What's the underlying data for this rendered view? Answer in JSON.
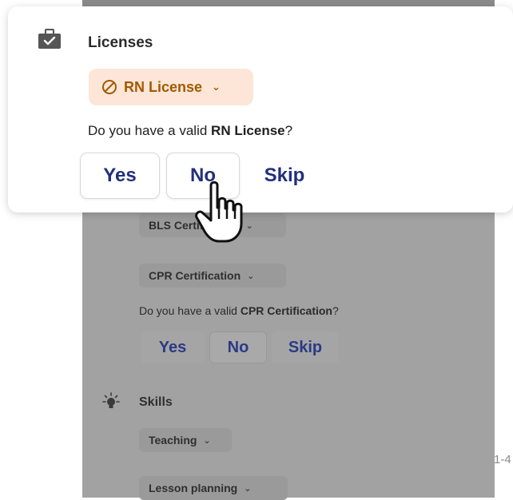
{
  "licenses_card": {
    "title": "Licenses",
    "license_pill": "RN License",
    "question_prefix": "Do you have a valid ",
    "question_bold": "RN License",
    "question_suffix": "?",
    "buttons": [
      "Yes",
      "No",
      "Skip"
    ]
  },
  "background": {
    "bls_pill": "BLS Certification",
    "cpr_pill": "CPR Certification",
    "cpr_question_prefix": "Do you have a valid ",
    "cpr_question_bold": "CPR Certification",
    "cpr_question_suffix": "?",
    "cpr_buttons": [
      "Yes",
      "No",
      "Skip"
    ],
    "skills_title": "Skills",
    "skills": [
      "Teaching",
      "Lesson planning"
    ],
    "page_marker": "1-4"
  },
  "colors": {
    "accent_text": "#22307a",
    "license_pill_bg": "#fde6d7",
    "license_pill_text": "#a25a00"
  },
  "icons": {
    "card_icon": "briefcase-check-icon",
    "license_icon": "ban-icon",
    "skills_icon": "lightbulb-icon",
    "cursor": "hand-pointer-icon"
  }
}
